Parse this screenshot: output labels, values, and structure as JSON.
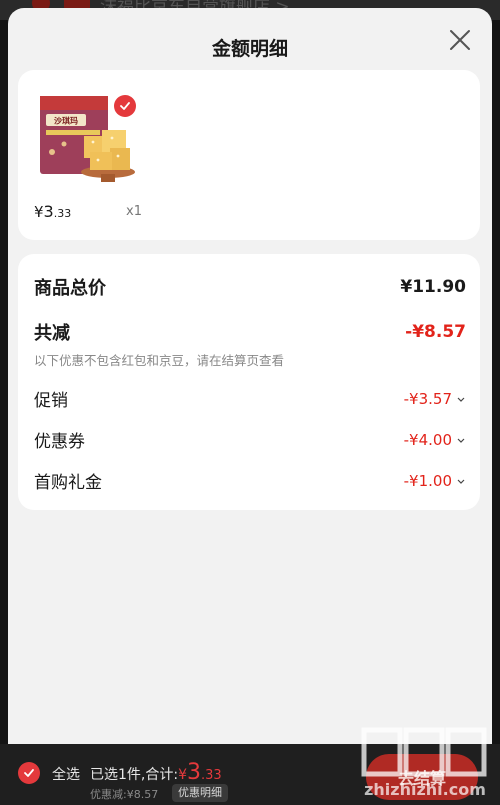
{
  "background": {
    "title": "沫福比京东自营旗舰店 >"
  },
  "sheet": {
    "title": "金额明细"
  },
  "product": {
    "image_icon": "pastry-product-image",
    "brand_text": "沙琪玛",
    "price_symbol": "¥",
    "price_int": "3",
    "price_dec": ".33",
    "quantity": "x1"
  },
  "detail": {
    "total_label": "商品总价",
    "total_value": "¥11.90",
    "reduce_label": "共减",
    "reduce_value": "-¥8.57",
    "note": "以下优惠不包含红包和京豆，请在结算页查看",
    "items": [
      {
        "label": "促销",
        "value": "-¥3.57"
      },
      {
        "label": "优惠券",
        "value": "-¥4.00"
      },
      {
        "label": "首购礼金",
        "value": "-¥1.00"
      }
    ]
  },
  "bottom": {
    "select_all": "全选",
    "summary_prefix": "已选1件,合计:",
    "total_symbol": "¥",
    "total_int": "3",
    "total_dec": ".33",
    "discount_text": "优惠减:¥8.57",
    "detail_button": "优惠明细",
    "checkout_button": "去结算"
  },
  "watermark": {
    "text": "zhizhizhi.com"
  },
  "colors": {
    "accent": "#e4393c",
    "red_text": "#e2231a",
    "sheet_bg": "#f2f2f2",
    "bar_bg": "#1f1f1f"
  }
}
